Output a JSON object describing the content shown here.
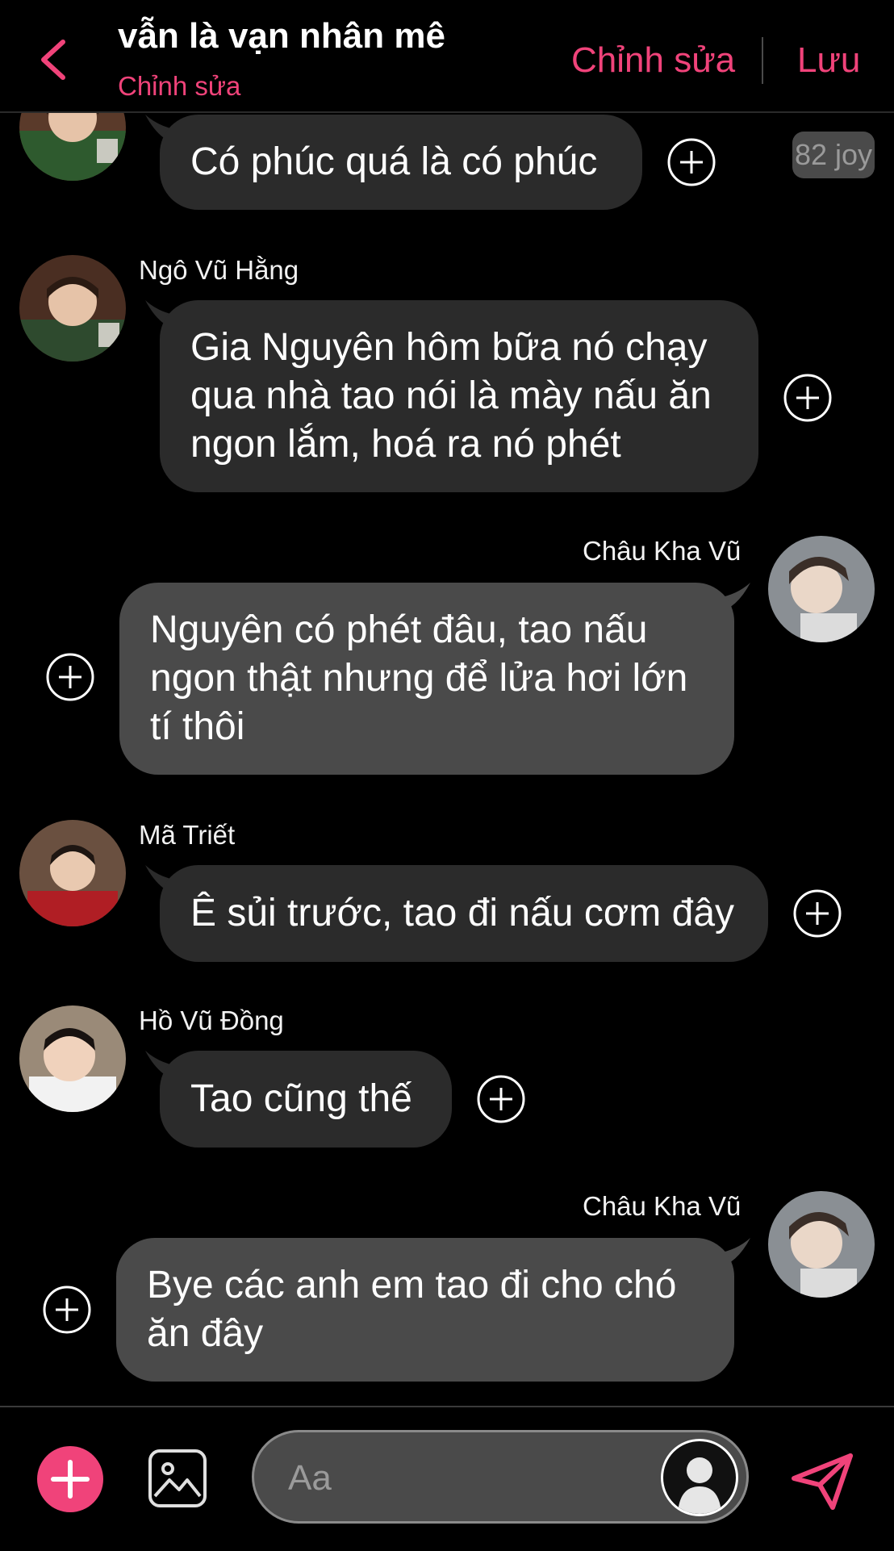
{
  "header": {
    "title": "vẫn là vạn nhân mê",
    "subtitle": "Chỉnh sửa",
    "edit_label": "Chỉnh sửa",
    "save_label": "Lưu",
    "accent_color": "#f0437a"
  },
  "badge": {
    "joy": "82 joy"
  },
  "messages": [
    {
      "sender": "",
      "text": "Có phúc quá là có phúc"
    },
    {
      "sender": "Ngô Vũ Hằng",
      "text": "Gia Nguyên hôm bữa nó chạy\nqua nhà tao nói là mày nấu ăn\nngon lắm, hoá ra nó phét"
    },
    {
      "sender": "Châu Kha Vũ",
      "text": "Nguyên có phét đâu, tao nấu\nngon thật nhưng để lửa hơi lớn\ntí thôi"
    },
    {
      "sender": "Mã Triết",
      "text": "Ê sủi trước, tao đi nấu cơm đây"
    },
    {
      "sender": "Hồ Vũ Đồng",
      "text": "Tao cũng thế"
    },
    {
      "sender": "Châu Kha Vũ",
      "text": "Bye các anh em tao đi cho chó\năn đây"
    }
  ],
  "composer": {
    "placeholder": "Aa",
    "icons": [
      "plus-icon",
      "image-icon",
      "avatar-icon",
      "send-icon"
    ]
  }
}
